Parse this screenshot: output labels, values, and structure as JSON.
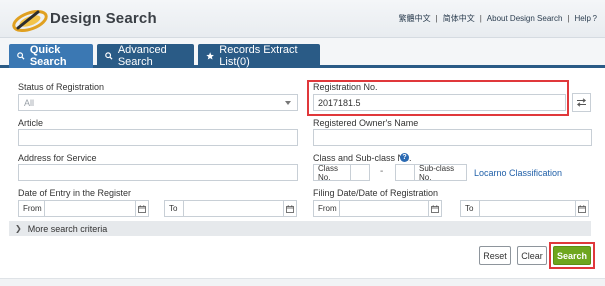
{
  "header": {
    "brand": "Design Search",
    "links": [
      "繁體中文",
      "简体中文",
      "About Design Search",
      "Help"
    ],
    "help_suffix": " ?"
  },
  "tabs": [
    {
      "label": "Quick Search",
      "icon": "search-icon",
      "active": true
    },
    {
      "label": "Advanced Search",
      "icon": "search-icon",
      "active": false
    },
    {
      "label": "Records Extract List(0)",
      "icon": "star-icon",
      "active": false
    }
  ],
  "form": {
    "status": {
      "label": "Status of Registration",
      "value": "All"
    },
    "registration_no": {
      "label": "Registration No.",
      "value": "2017181.5"
    },
    "article": {
      "label": "Article",
      "value": ""
    },
    "owner": {
      "label": "Registered Owner's Name",
      "value": ""
    },
    "address": {
      "label": "Address for Service",
      "value": ""
    },
    "class": {
      "label": "Class and Sub-class No.",
      "class_prefix": "Class No.",
      "dash": "-",
      "subclass_prefix": "Sub-class No.",
      "locarno_link": "Locarno Classification"
    },
    "entry_date": {
      "label": "Date of Entry in the Register",
      "from": "From",
      "to": "To"
    },
    "filing_date": {
      "label": "Filing Date/Date of Registration",
      "from": "From",
      "to": "To"
    },
    "more_criteria": "More search criteria"
  },
  "buttons": {
    "reset": "Reset",
    "clear": "Clear",
    "search": "Search"
  },
  "colors": {
    "primary_blue": "#2a5b86",
    "active_tab": "#3b78b3",
    "search_green": "#6fa61e",
    "highlight_red": "#e0383b"
  }
}
